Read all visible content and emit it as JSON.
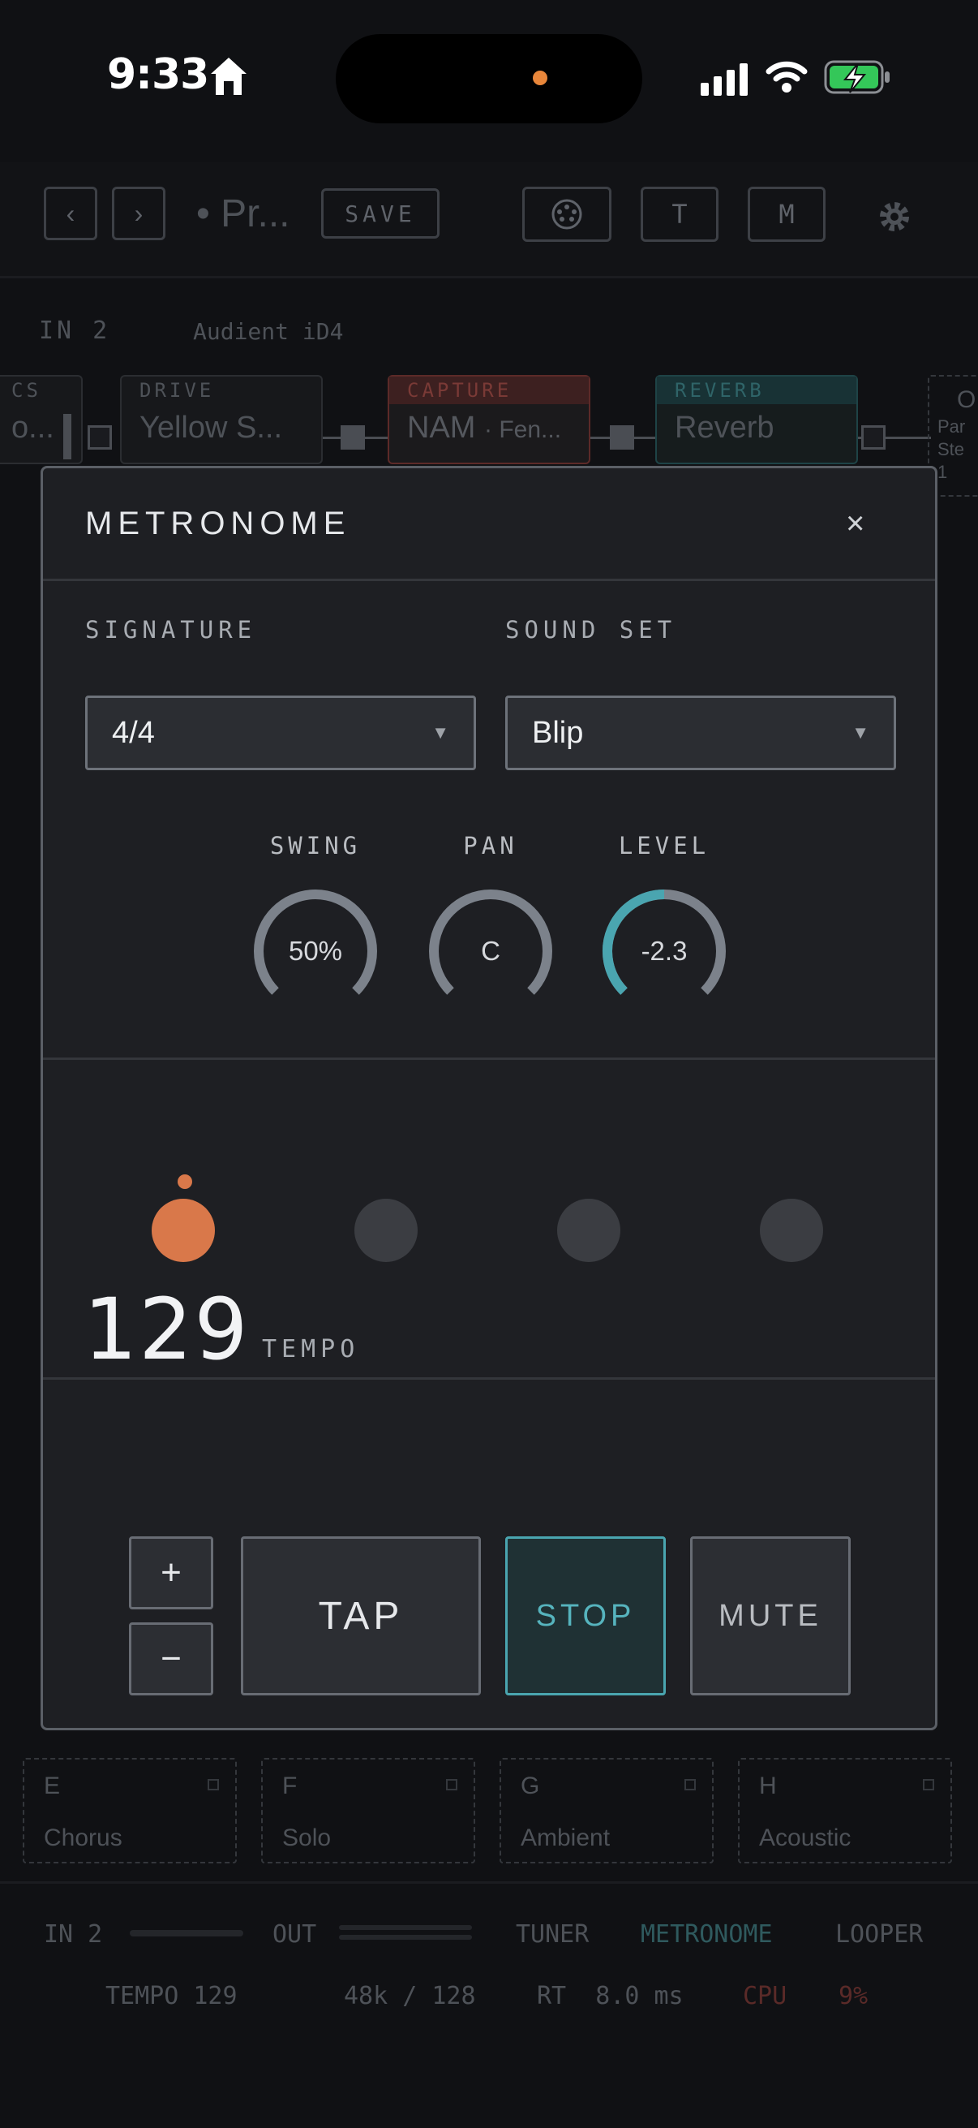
{
  "status_bar": {
    "time": "9:33"
  },
  "background": {
    "toolbar": {
      "prev": "‹",
      "next": "›",
      "preset_name": "• Pr...",
      "save_label": "SAVE",
      "t_label": "T",
      "m_label": "M"
    },
    "input_row": {
      "input": "IN 2",
      "device": "Audient iD4"
    },
    "chain": [
      {
        "category": "CS",
        "name": "o..."
      },
      {
        "category": "DRIVE",
        "name": "Yellow S..."
      },
      {
        "category": "CAPTURE",
        "name": "NAM",
        "sub": "· Fen..."
      },
      {
        "category": "REVERB",
        "name": "Reverb"
      },
      {
        "category": "O",
        "name": "Par Ste 1"
      }
    ],
    "slots": [
      {
        "letter": "E",
        "name": "Chorus"
      },
      {
        "letter": "F",
        "name": "Solo"
      },
      {
        "letter": "G",
        "name": "Ambient"
      },
      {
        "letter": "H",
        "name": "Acoustic"
      }
    ],
    "bottom_bar": {
      "in": "IN 2",
      "out": "OUT",
      "tuner": "TUNER",
      "metronome": "METRONOME",
      "looper": "LOOPER"
    },
    "stats": {
      "tempo": "TEMPO 129",
      "rate": "48k / 128",
      "rt": "RT  8.0 ms",
      "cpu": "CPU",
      "cpu_value": "9%"
    }
  },
  "modal": {
    "title": "METRONOME",
    "close": "×",
    "signature": {
      "label": "SIGNATURE",
      "value": "4/4"
    },
    "sound_set": {
      "label": "SOUND SET",
      "value": "Blip"
    },
    "knobs": [
      {
        "label": "SWING",
        "value": "50%",
        "level": 0.0,
        "color": "#7c828b"
      },
      {
        "label": "PAN",
        "value": "C",
        "level": 0.0,
        "color": "#7c828b"
      },
      {
        "label": "LEVEL",
        "value": "-2.3",
        "level": 0.5,
        "color": "#4aa5b0"
      }
    ],
    "beats": {
      "count": 4,
      "active": 1
    },
    "tempo": {
      "value": "129",
      "label": "TEMPO"
    },
    "buttons": {
      "plus": "+",
      "minus": "−",
      "tap": "TAP",
      "stop": "STOP",
      "mute": "MUTE"
    }
  },
  "colors": {
    "accent_orange": "#d9784a",
    "accent_teal": "#4aa5b0",
    "capture_red": "#c9413b"
  }
}
